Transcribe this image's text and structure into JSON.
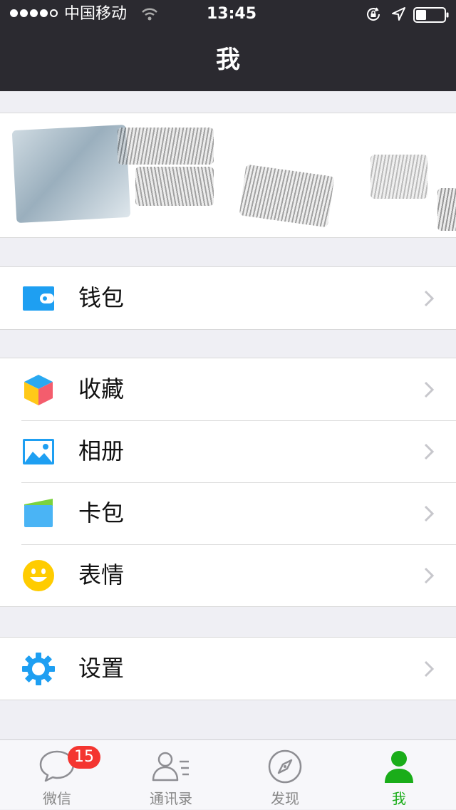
{
  "status_bar": {
    "carrier": "中国移动",
    "time": "13:45"
  },
  "header": {
    "title": "我"
  },
  "menu": {
    "wallet": {
      "label": "钱包"
    },
    "favorites": {
      "label": "收藏"
    },
    "album": {
      "label": "相册"
    },
    "cards": {
      "label": "卡包"
    },
    "stickers": {
      "label": "表情"
    },
    "settings": {
      "label": "设置"
    }
  },
  "tabbar": {
    "chats": {
      "label": "微信",
      "badge": "15"
    },
    "contacts": {
      "label": "通讯录"
    },
    "discover": {
      "label": "发现"
    },
    "me": {
      "label": "我"
    }
  },
  "colors": {
    "header_bg": "#2b2a30",
    "page_bg": "#efeff4",
    "accent_green": "#1aad19",
    "badge_red": "#f43530",
    "icon_blue": "#1e9ff2"
  },
  "icons": {
    "wallet": "wallet-icon",
    "favorites": "cube-icon",
    "album": "photo-icon",
    "cards": "card-icon",
    "stickers": "smiley-icon",
    "settings": "gear-icon"
  }
}
